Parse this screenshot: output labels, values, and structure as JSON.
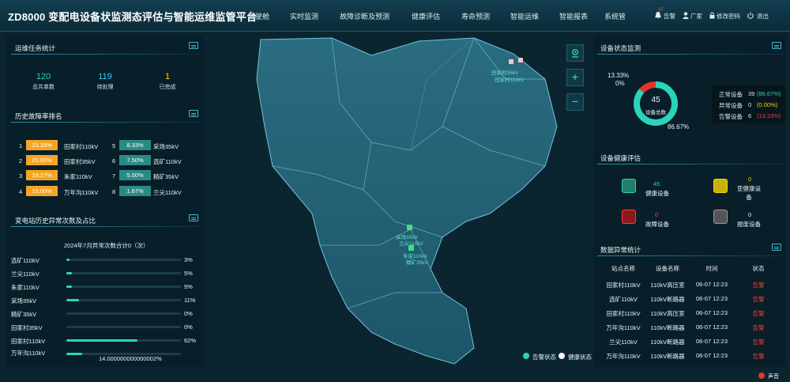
{
  "header": {
    "title": "ZD8000 变配电设备状监测态评估与智能运维监管平台",
    "nav": [
      "驾驶舱",
      "实时监测",
      "故障诊断及预测",
      "健康评估",
      "寿命预测",
      "智能运维",
      "智能报表",
      "系统管"
    ],
    "alarm_badge": "37",
    "alarm_label": "告警",
    "user_label": "厂家",
    "password_label": "修改密码",
    "logout_label": "退出"
  },
  "ops_stats": {
    "title": "运维任务统计",
    "items": [
      {
        "value": "120",
        "label": "总共单数"
      },
      {
        "value": "119",
        "label": "待处理"
      },
      {
        "value": "1",
        "label": "已完成"
      }
    ]
  },
  "fault_rank": {
    "title": "历史故障率排名",
    "left": [
      {
        "rank": "1",
        "pct": "23.33%",
        "name": "田家村110kV"
      },
      {
        "rank": "2",
        "pct": "20.00%",
        "name": "田家村35kV"
      },
      {
        "rank": "3",
        "pct": "19.17%",
        "name": "朱家110kV"
      },
      {
        "rank": "4",
        "pct": "15.00%",
        "name": "万年沟110kV"
      }
    ],
    "right": [
      {
        "rank": "5",
        "pct": "8.33%",
        "name": "采场35kV"
      },
      {
        "rank": "6",
        "pct": "7.50%",
        "name": "选矿110kV"
      },
      {
        "rank": "7",
        "pct": "5.00%",
        "name": "精矿35kV"
      },
      {
        "rank": "8",
        "pct": "1.67%",
        "name": "兰尖110kV"
      }
    ]
  },
  "anomaly": {
    "title": "变电站历史异常次数及占比",
    "subtitle": "2024年7月异常次数合计0（次）",
    "rows": [
      {
        "name": "选矿110kV",
        "pct": 3,
        "label": "3%"
      },
      {
        "name": "兰尖110kV",
        "pct": 5,
        "label": "5%"
      },
      {
        "name": "朱家110kV",
        "pct": 5,
        "label": "5%"
      },
      {
        "name": "采场35kV",
        "pct": 11,
        "label": "11%"
      },
      {
        "name": "精矿35kV",
        "pct": 0,
        "label": "0%"
      },
      {
        "name": "田家村35kV",
        "pct": 0,
        "label": "0%"
      },
      {
        "name": "田家村110kV",
        "pct": 62,
        "label": "62%"
      },
      {
        "name": "万年沟110kV",
        "pct": 14,
        "label": "14.000000000000002%"
      }
    ]
  },
  "map": {
    "labels": [
      "田家村35kV",
      "田家村110kV",
      "采场35kV",
      "兰尖110kV",
      "朱家110kV",
      "精矿35kV"
    ],
    "legend_alarm": "告警状态",
    "legend_health": "健康状态",
    "alarm_color": "#2bd4b9",
    "health_color": "#ffffff"
  },
  "device_status": {
    "title": "设备状态监测",
    "total": "45",
    "total_label": "设备总数",
    "pct_top": "13.33%",
    "pct_zero": "0%",
    "pct_main": "86.67%",
    "normal_pct": 86.67,
    "alarm_pct": 13.33,
    "rows": [
      {
        "label": "正常设备",
        "count": "39",
        "pct": "(86.67%)",
        "color": "#2bd4b9"
      },
      {
        "label": "异常设备",
        "count": "0",
        "pct": "(0.00%)",
        "color": "#f5d60a"
      },
      {
        "label": "告警设备",
        "count": "6",
        "pct": "(13.33%)",
        "color": "#ff3b3b"
      }
    ]
  },
  "health": {
    "title": "设备健康评估",
    "items": [
      {
        "value": "45",
        "label": "健康设备",
        "color": "#2bd4b9"
      },
      {
        "value": "0",
        "label": "亚健康设备",
        "color": "#f5d60a"
      },
      {
        "value": "0",
        "label": "故障设备",
        "color": "#ff3b3b"
      },
      {
        "value": "0",
        "label": "报废设备",
        "color": "#9a9a9a"
      }
    ]
  },
  "anomaly_table": {
    "title": "数据异常统计",
    "headers": [
      "站点名称",
      "设备名称",
      "时间",
      "状态"
    ],
    "rows": [
      [
        "田家村110kV",
        "110kV高压室",
        "06-07 12:23",
        "告警"
      ],
      [
        "选矿110kV",
        "110kV断路器",
        "06-07 12:23",
        "告警"
      ],
      [
        "田家村110kV",
        "110kV高压室",
        "06-07 12:23",
        "告警"
      ],
      [
        "万年沟110kV",
        "110kV断路器",
        "06-07 12:23",
        "告警"
      ],
      [
        "兰尖110kV",
        "110kV断路器",
        "06-07 12:23",
        "告警"
      ],
      [
        "万年沟110kV",
        "110kV断路器",
        "06-07 12:23",
        "告警"
      ]
    ]
  },
  "sound_label": "声音"
}
